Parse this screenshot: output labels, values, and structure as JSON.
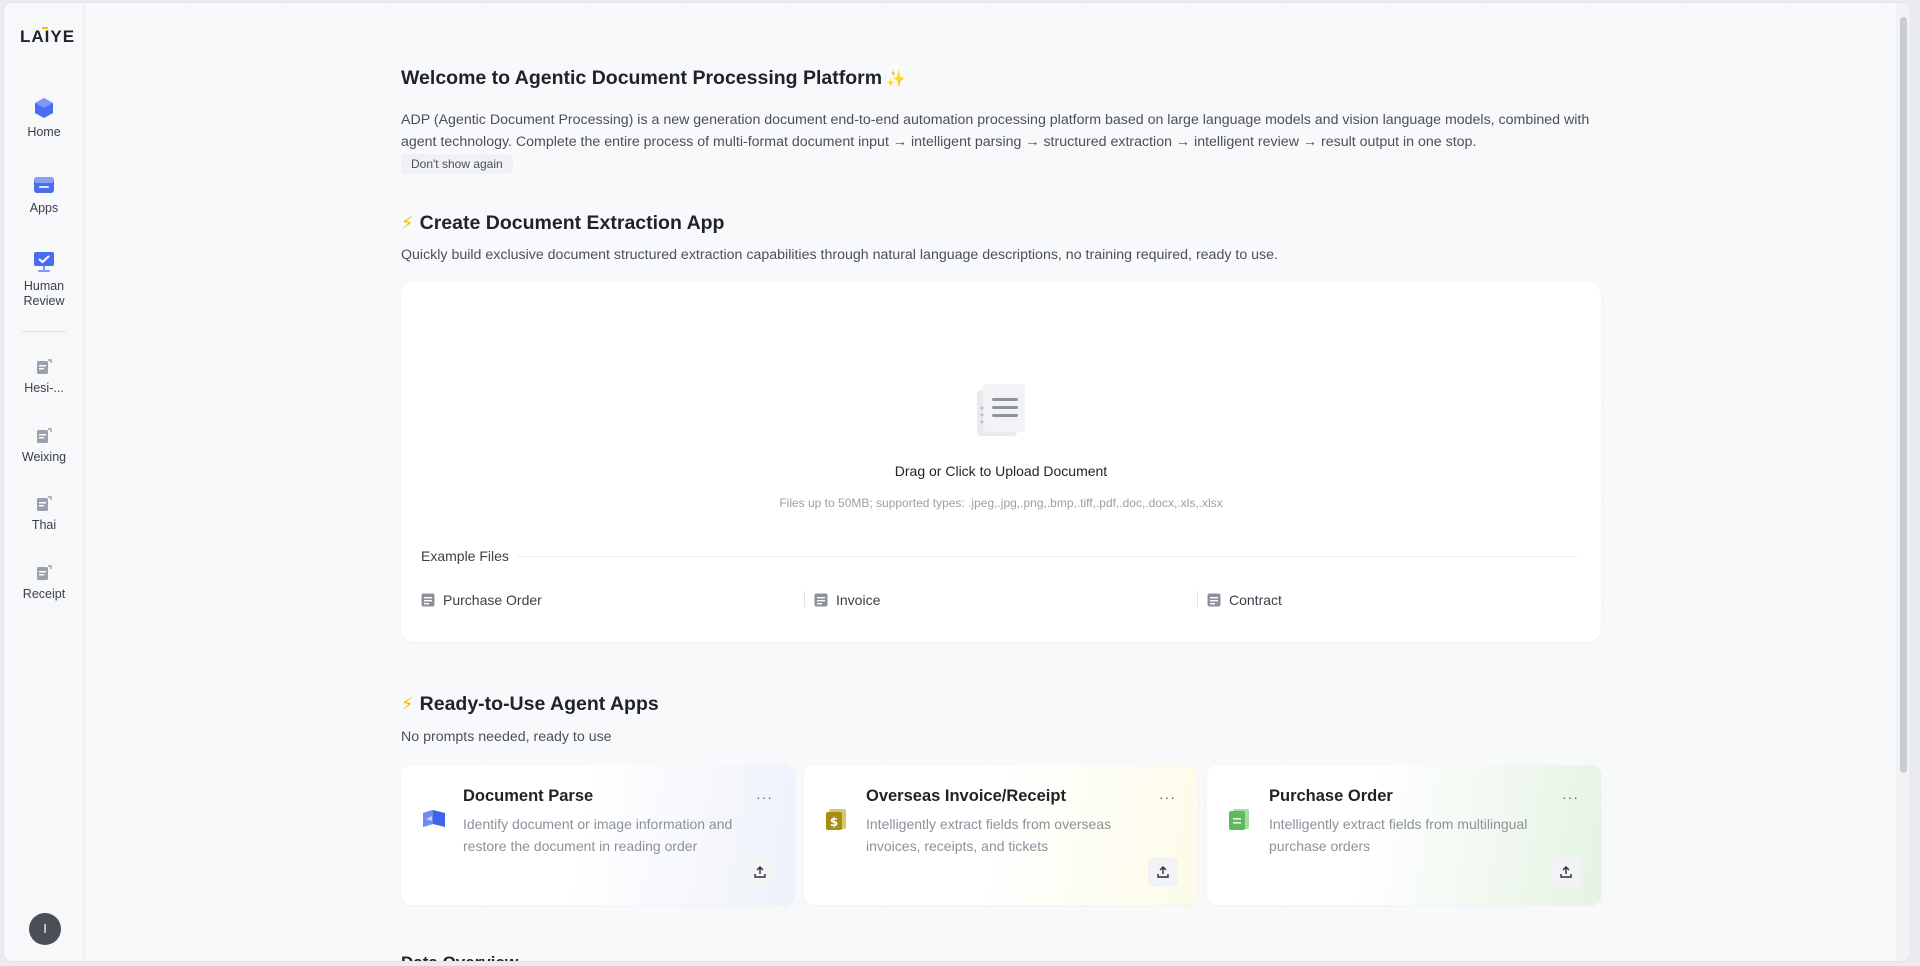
{
  "sidebar": {
    "logo": "LAIYE",
    "items": [
      {
        "label": "Home",
        "icon": "home-icon"
      },
      {
        "label": "Apps",
        "icon": "apps-icon"
      },
      {
        "label": "Human Review",
        "icon": "human-review-icon"
      },
      {
        "label": "Hesi-...",
        "icon": "app-document-icon"
      },
      {
        "label": "Weixing",
        "icon": "app-document-icon"
      },
      {
        "label": "Thai",
        "icon": "app-document-icon"
      },
      {
        "label": "Receipt",
        "icon": "app-document-icon"
      }
    ],
    "avatar_initial": "I"
  },
  "welcome": {
    "title": "Welcome to Agentic Document Processing Platform",
    "sparkle": "✨",
    "intro": "ADP (Agentic Document Processing) is a new generation document end-to-end automation processing platform based on large language models and vision language models, combined with agent technology. Complete the entire process of multi-format document input → intelligent parsing → structured extraction → intelligent review → result output in one stop.",
    "dont_show": "Don't show again"
  },
  "create_app": {
    "title": "Create Document Extraction App",
    "subtitle": "Quickly build exclusive document structured extraction capabilities through natural language descriptions, no training required, ready to use.",
    "upload_title": "Drag or Click to Upload Document",
    "upload_hint": "Files up to 50MB; supported types: .jpeg,.jpg,.png,.bmp,.tiff,.pdf,.doc,.docx,.xls,.xlsx",
    "example_label": "Example Files",
    "examples": [
      "Purchase Order",
      "Invoice",
      "Contract"
    ]
  },
  "agent_apps": {
    "title": "Ready-to-Use Agent Apps",
    "subtitle": "No prompts needed, ready to use",
    "more_label": "···",
    "cards": [
      {
        "title": "Document Parse",
        "desc": "Identify document or image information and restore the document in reading order",
        "icon": "document-parse-icon"
      },
      {
        "title": "Overseas Invoice/Receipt",
        "desc": "Intelligently extract fields from overseas invoices, receipts, and tickets",
        "icon": "invoice-icon"
      },
      {
        "title": "Purchase Order",
        "desc": "Intelligently extract fields from multilingual purchase orders",
        "icon": "purchase-order-icon"
      }
    ]
  },
  "data_overview": {
    "title": "Data Overview"
  },
  "colors": {
    "accent_blue": "#3f63e8",
    "bolt_yellow": "#f5c000",
    "invoice_gold": "#b59a1e",
    "po_green": "#6cc46a"
  }
}
